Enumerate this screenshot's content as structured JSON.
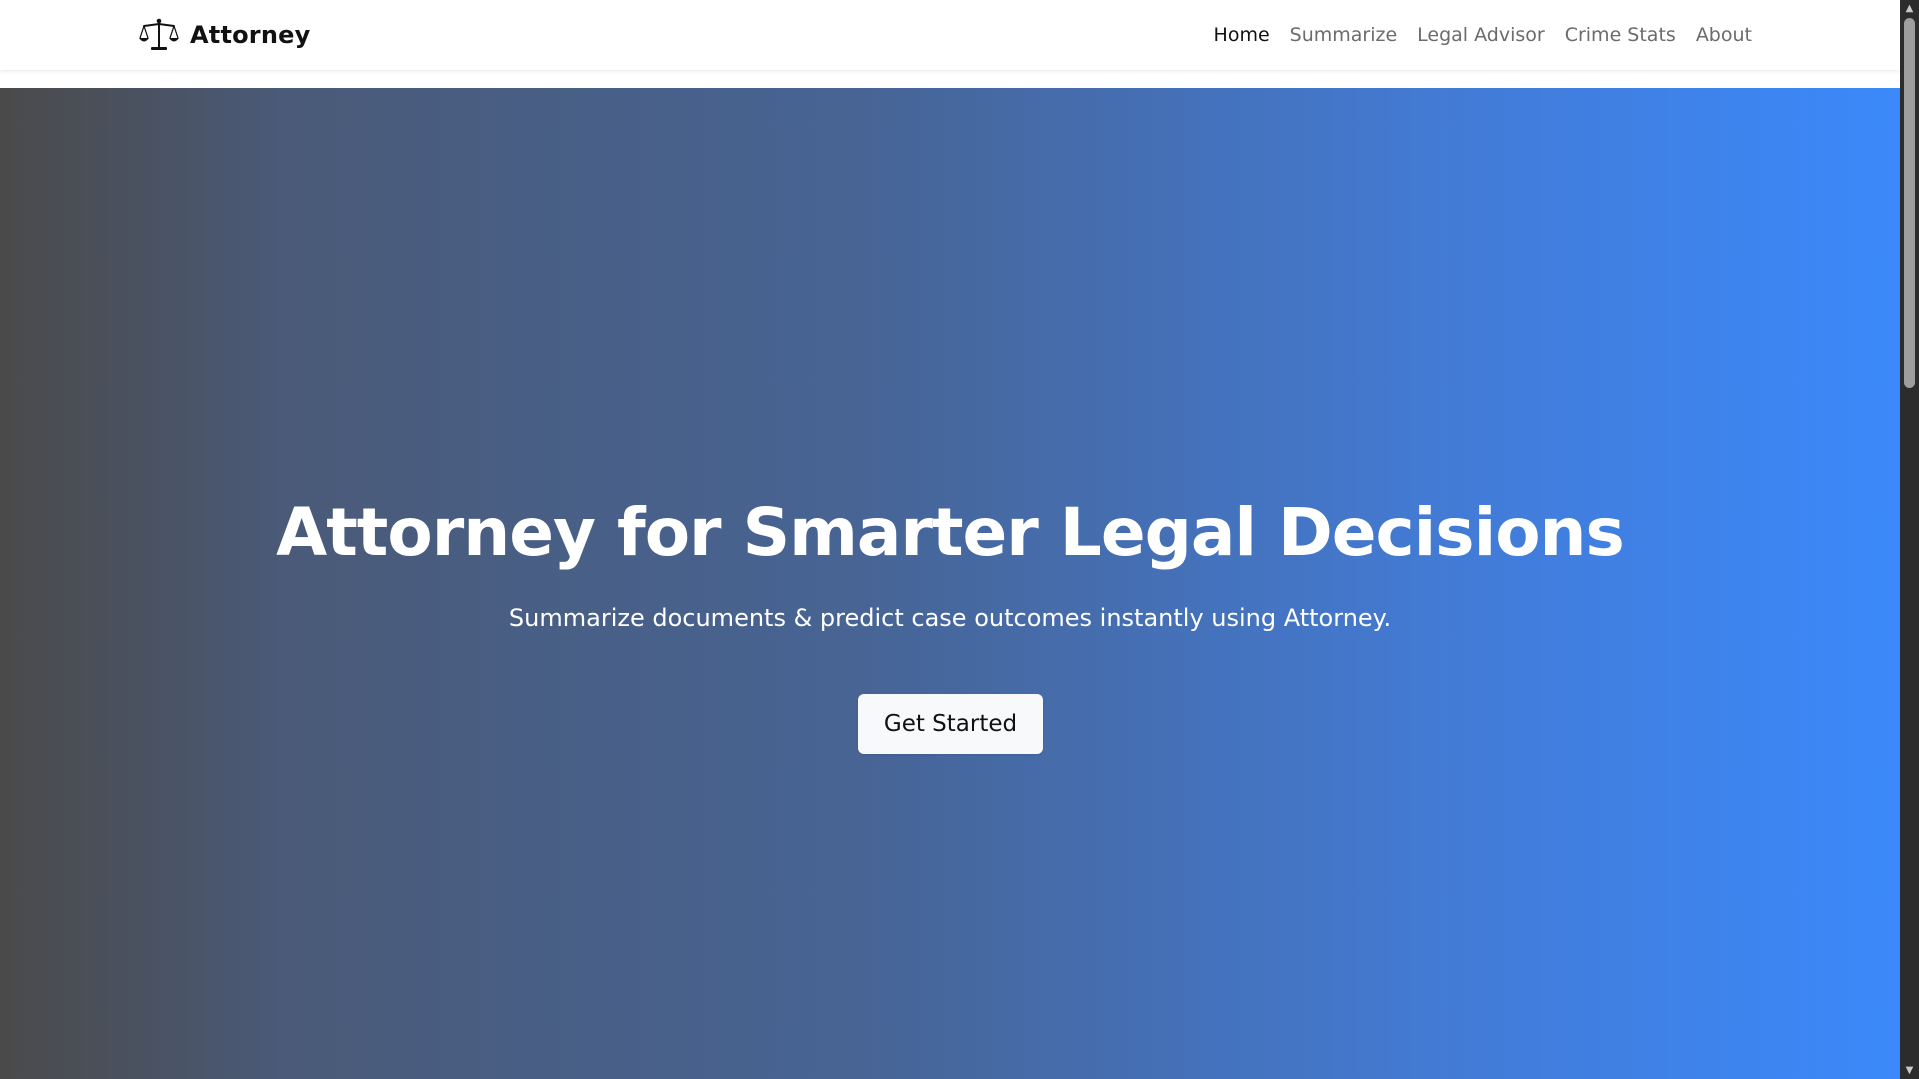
{
  "app": {
    "brand_name": "Attorney",
    "brand_icon": "scales-of-justice-icon"
  },
  "nav": {
    "items": [
      {
        "label": "Home",
        "active": true
      },
      {
        "label": "Summarize",
        "active": false
      },
      {
        "label": "Legal Advisor",
        "active": false
      },
      {
        "label": "Crime Stats",
        "active": false
      },
      {
        "label": "About",
        "active": false
      }
    ]
  },
  "hero": {
    "title": "Attorney for Smarter Legal Decisions",
    "subtitle": "Summarize documents & predict case outcomes instantly using Attorney.",
    "cta_label": "Get Started",
    "gradient_colors": [
      "#4a4a4a",
      "#476494",
      "#3b89fb"
    ]
  },
  "colors": {
    "nav_active": "#111111",
    "nav_inactive": "#6b6b6b",
    "accent": "#3b89fb",
    "scrollbar_track": "#2c2c2c",
    "scrollbar_thumb": "#9e9e9e"
  },
  "scrollbar": {
    "up_icon": "triangle-up-icon",
    "down_icon": "triangle-down-icon"
  }
}
